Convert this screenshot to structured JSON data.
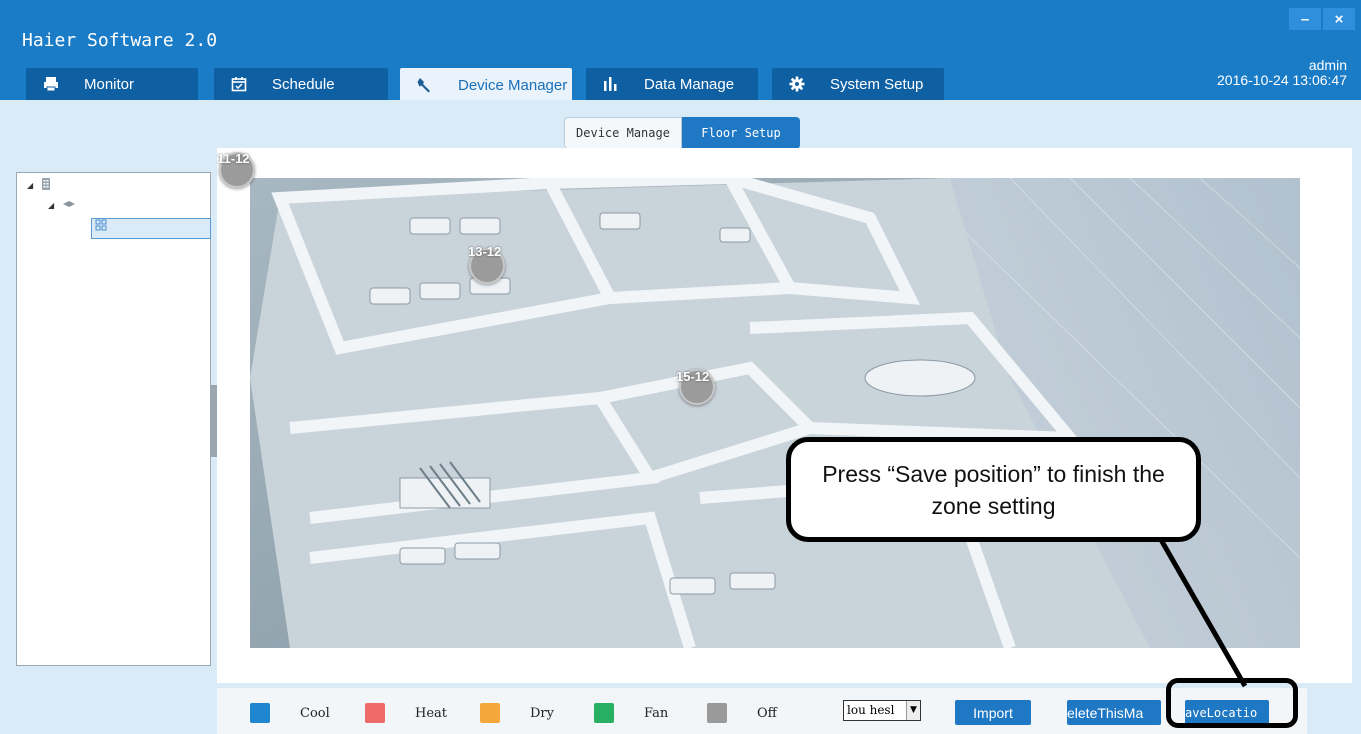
{
  "app": {
    "title": "Haier Software 2.0"
  },
  "window_buttons": {
    "minimize": "–",
    "close": "×"
  },
  "tabs": [
    {
      "label": "Monitor",
      "icon": "printer-icon",
      "glyph": "🖶",
      "active": false
    },
    {
      "label": "Schedule",
      "icon": "calendar-icon",
      "glyph": "🗓",
      "active": false
    },
    {
      "label": "Device Manager",
      "icon": "wrench-icon",
      "glyph": "🔧",
      "active": true
    },
    {
      "label": "Data Manage",
      "icon": "bar-chart-icon",
      "glyph": "▮▮▮",
      "active": false
    },
    {
      "label": "System Setup",
      "icon": "gear-icon",
      "glyph": "⚙",
      "active": false
    }
  ],
  "user": {
    "name": "admin",
    "datetime": "2016-10-24 13:06:47"
  },
  "subtabs": [
    {
      "label": "Device Manage",
      "active": false
    },
    {
      "label": "Floor Setup",
      "active": true
    }
  ],
  "tree": {
    "root_icon": "building-icon",
    "floor_icon": "floor-icon",
    "zone_icon": "grid-icon"
  },
  "zones": [
    {
      "label": "11-12"
    },
    {
      "label": "13-12"
    },
    {
      "label": "15-12"
    }
  ],
  "callout": {
    "text": "Press “Save position” to finish the zone setting"
  },
  "legend": [
    {
      "label": "Cool",
      "color": "#1f86cf"
    },
    {
      "label": "Heat",
      "color": "#ef6b6b"
    },
    {
      "label": "Dry",
      "color": "#f4a83b"
    },
    {
      "label": "Fan",
      "color": "#27b063"
    },
    {
      "label": "Off",
      "color": "#9a9a9a"
    }
  ],
  "floor_select": {
    "value": "lou hesl"
  },
  "buttons": {
    "import": "Import",
    "delete_map": "eleteThisMa",
    "save_location": "aveLocatio"
  }
}
